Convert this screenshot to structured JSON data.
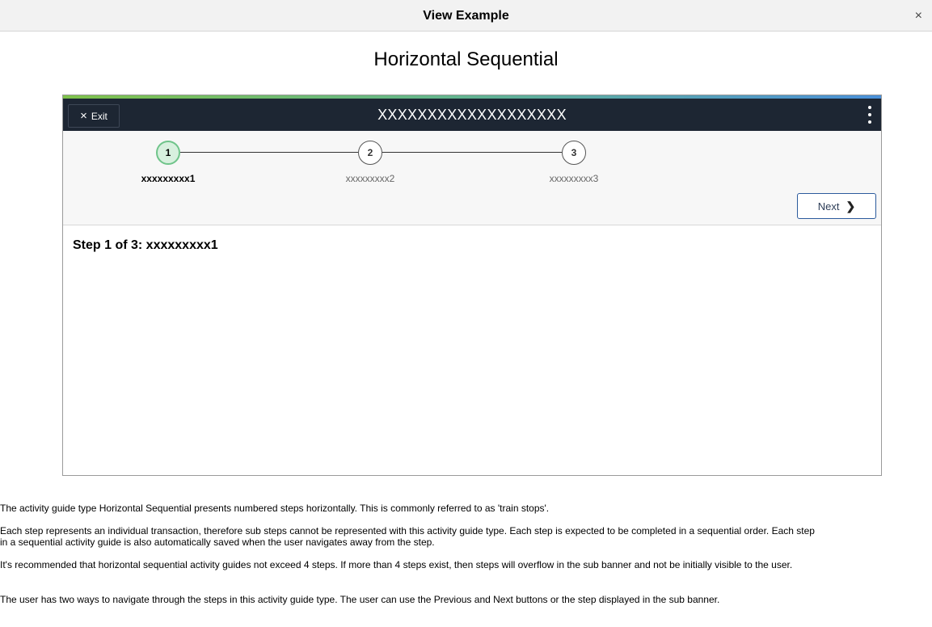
{
  "dialog": {
    "title": "View Example",
    "close_label": "×"
  },
  "page": {
    "heading": "Horizontal Sequential"
  },
  "example": {
    "exit_icon": "×",
    "exit_label": "Exit",
    "banner_title": "XXXXXXXXXXXXXXXXXXX",
    "steps": [
      {
        "number": "1",
        "label": "xxxxxxxxx1",
        "active": true
      },
      {
        "number": "2",
        "label": "xxxxxxxxx2",
        "active": false
      },
      {
        "number": "3",
        "label": "xxxxxxxxx3",
        "active": false
      }
    ],
    "next_label": "Next",
    "next_icon": "chevron-right-icon",
    "next_glyph": "❯",
    "step_heading": "Step 1 of 3: xxxxxxxxx1",
    "colors": {
      "banner": "#1d2633",
      "active_step_fill": "#d7f0de",
      "active_step_border": "#6fc48a",
      "next_border": "#2b5a9c"
    }
  },
  "description": [
    "The activity guide type Horizontal Sequential presents numbered steps horizontally.  This is commonly referred to as 'train stops'.",
    "Each step represents an individual transaction, therefore sub steps cannot be represented with this activity guide type.  Each step is expected to be completed in a sequential order.  Each step in a sequential activity guide is also automatically saved when the user navigates away from the step.",
    "It's recommended that horizontal sequential activity guides not exceed 4 steps.  If more than 4 steps exist, then steps will overflow in the sub banner and not be initially visible to the user.",
    "The user has two ways to navigate through the steps in this activity guide type.  The user can use the Previous and Next buttons or the step displayed in the sub banner."
  ]
}
